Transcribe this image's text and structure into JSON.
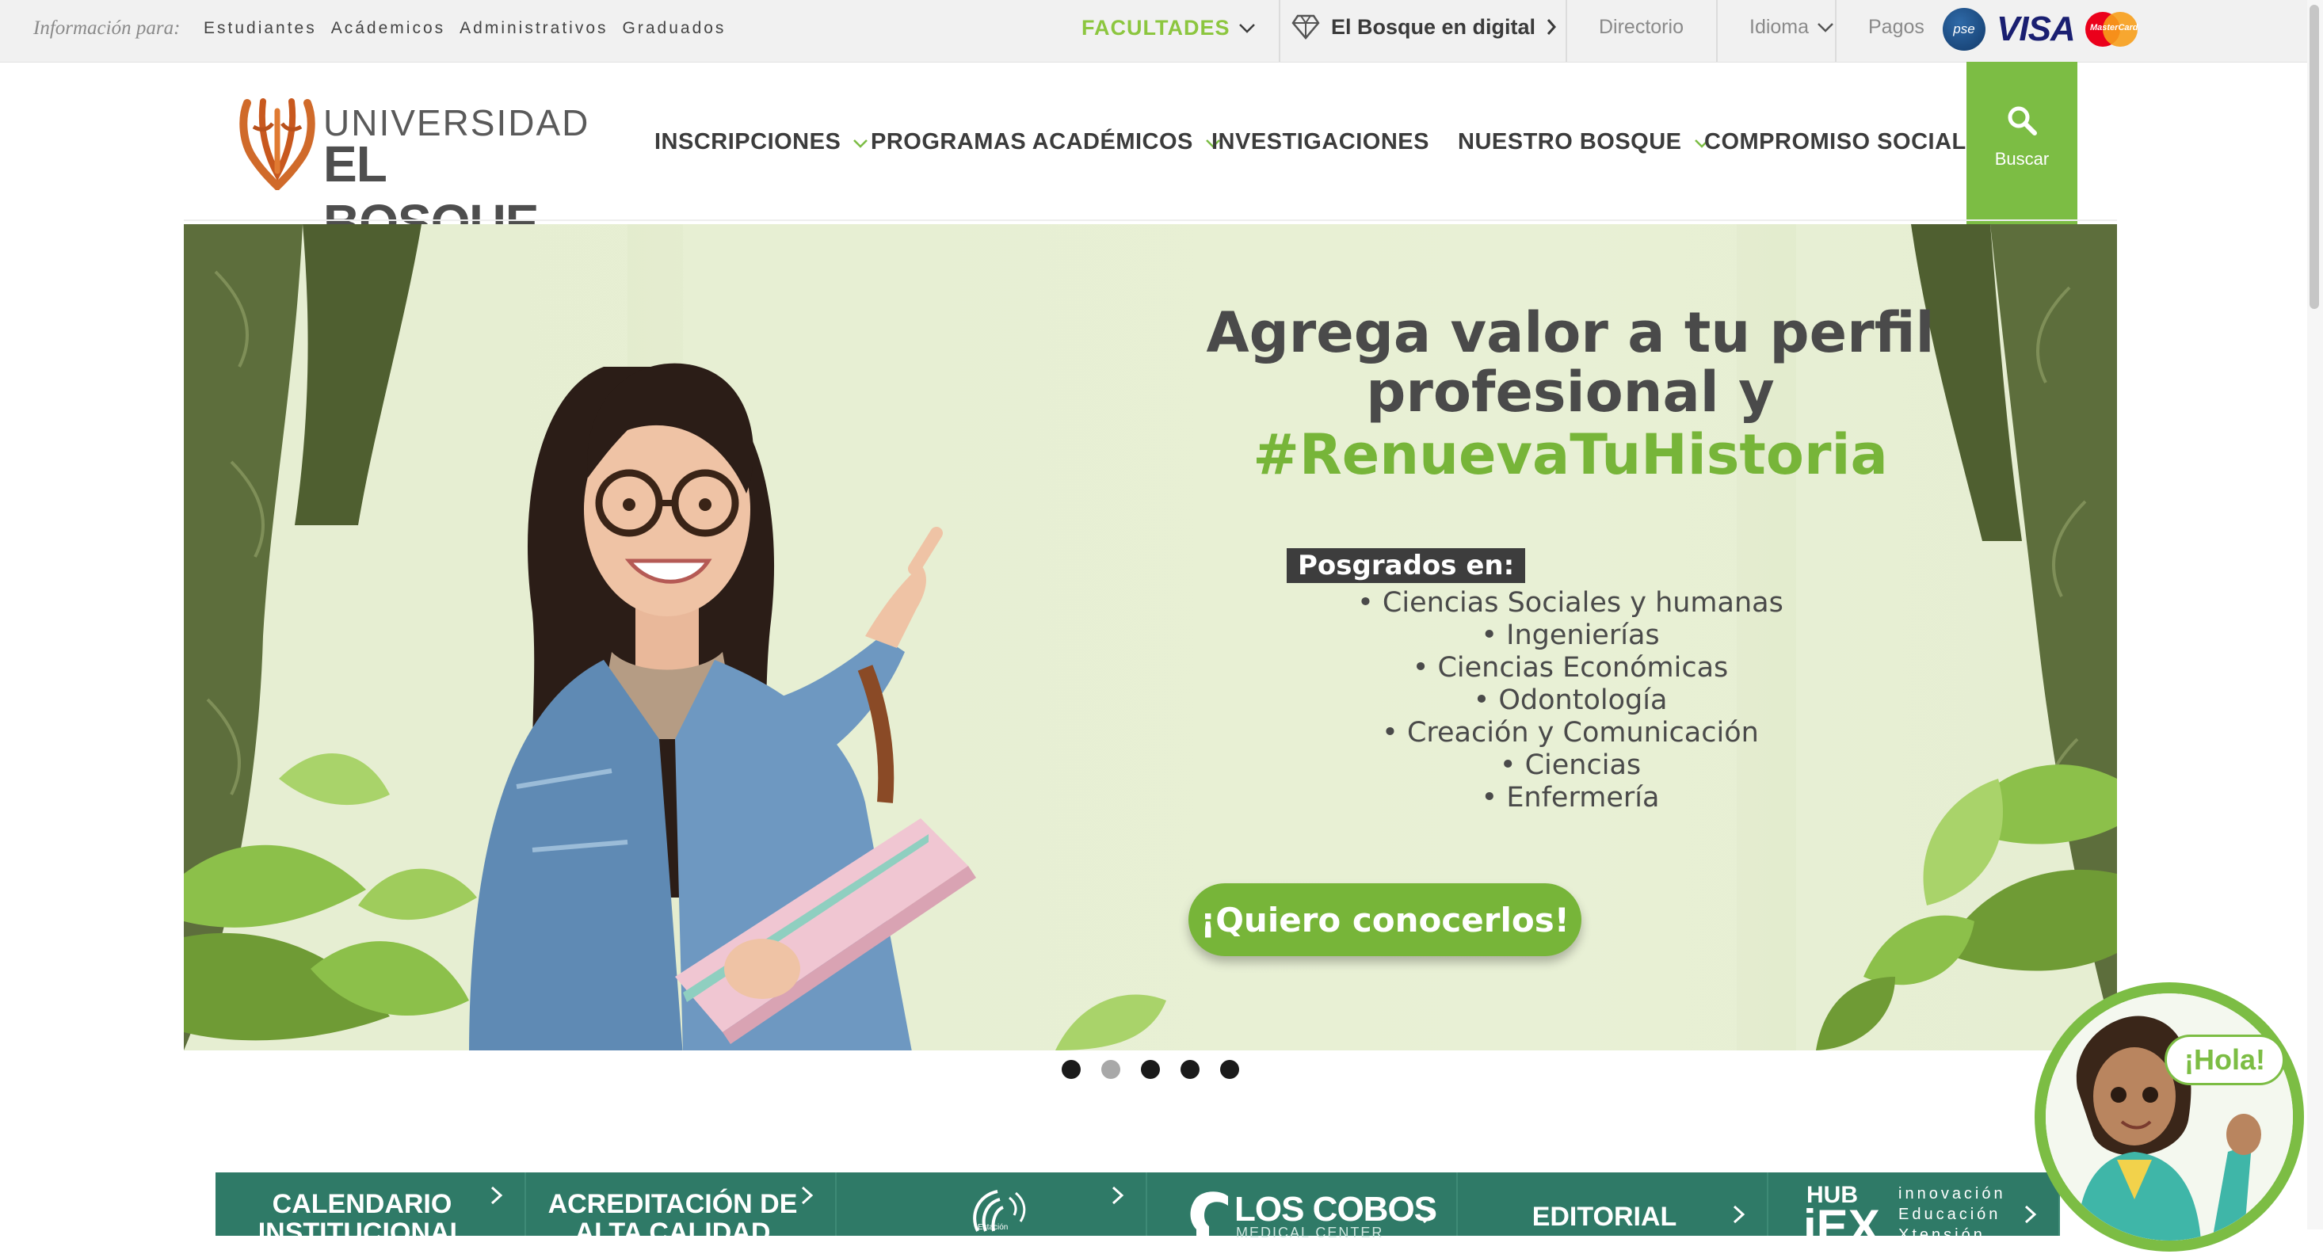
{
  "topbar": {
    "info_label": "Información para:",
    "audience": [
      "Estudiantes",
      "Acádemicos",
      "Administrativos",
      "Graduados"
    ],
    "facultades": "FACULTADES",
    "digital": "El Bosque en digital",
    "directorio": "Directorio",
    "idioma": "Idioma",
    "pagos": "Pagos",
    "pse": "pse",
    "visa": "VISA",
    "mastercard": "MasterCard"
  },
  "logo": {
    "top": "UNIVERSIDAD",
    "bottom": "EL BOSQUE"
  },
  "nav": {
    "inscripciones": "INSCRIPCIONES",
    "programas": "PROGRAMAS ACADÉMICOS",
    "investigaciones": "INVESTIGACIONES",
    "nuestro": "NUESTRO BOSQUE",
    "compromiso": "COMPROMISO SOCIAL",
    "buscar": "Buscar"
  },
  "hero": {
    "headline_1": "Agrega valor a tu perfil",
    "headline_2": "profesional y",
    "hashtag": "#RenuevaTuHistoria",
    "posgrados_label": "Posgrados en:",
    "programs": [
      "• Ciencias Sociales y humanas",
      "• Ingenierías",
      "• Ciencias Económicas",
      "• Odontología",
      "• Creación y Comunicación",
      "• Ciencias",
      "• Enfermería"
    ],
    "cta": "¡Quiero conocerlos!"
  },
  "carousel": {
    "count": 5,
    "active_index": 1
  },
  "quick_links": {
    "calendario": "CALENDARIO INSTITUCIONAL",
    "acreditacion": "ACREDITACIÓN DE ALTA CALIDAD",
    "estacion": "Estación",
    "loscobos": "LOS COBOS",
    "loscobos_sub": "MEDICAL CENTER",
    "editorial": "EDITORIAL",
    "hub": "HUB",
    "hub_mark": "iEX",
    "hub_text": "innovación Educación Xtensión"
  },
  "chat": {
    "greeting": "¡Hola!"
  },
  "colors": {
    "brand_green": "#7cbd44",
    "teal": "#2f7a67",
    "nav_text": "#3c3c3c"
  }
}
